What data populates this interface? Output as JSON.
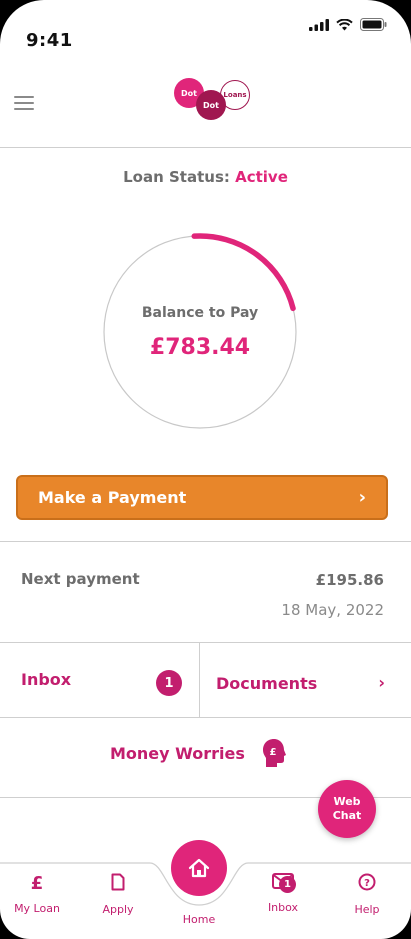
{
  "status_bar": {
    "time": "9:41"
  },
  "header": {
    "logo": {
      "word1": "Dot",
      "word2": "Dot",
      "word3": "Loans"
    }
  },
  "loan_status": {
    "label": "Loan Status:",
    "value": "Active"
  },
  "balance": {
    "label": "Balance to Pay",
    "amount": "£783.44",
    "progress_fraction": 0.22
  },
  "payment_button": {
    "label": "Make a Payment"
  },
  "next_payment": {
    "label": "Next payment",
    "amount": "£195.86",
    "date": "18 May, 2022"
  },
  "tiles": {
    "inbox": {
      "label": "Inbox",
      "badge": "1"
    },
    "documents": {
      "label": "Documents"
    },
    "money_worries": {
      "label": "Money Worries"
    }
  },
  "webchat": {
    "line1": "Web",
    "line2": "Chat"
  },
  "tabbar": {
    "my_loan": "My Loan",
    "apply": "Apply",
    "home": "Home",
    "inbox": "Inbox",
    "inbox_badge": "1",
    "help": "Help"
  },
  "colors": {
    "accent": "#e0257a",
    "accent_dark": "#c21e6e",
    "button_orange": "#e8862a"
  }
}
